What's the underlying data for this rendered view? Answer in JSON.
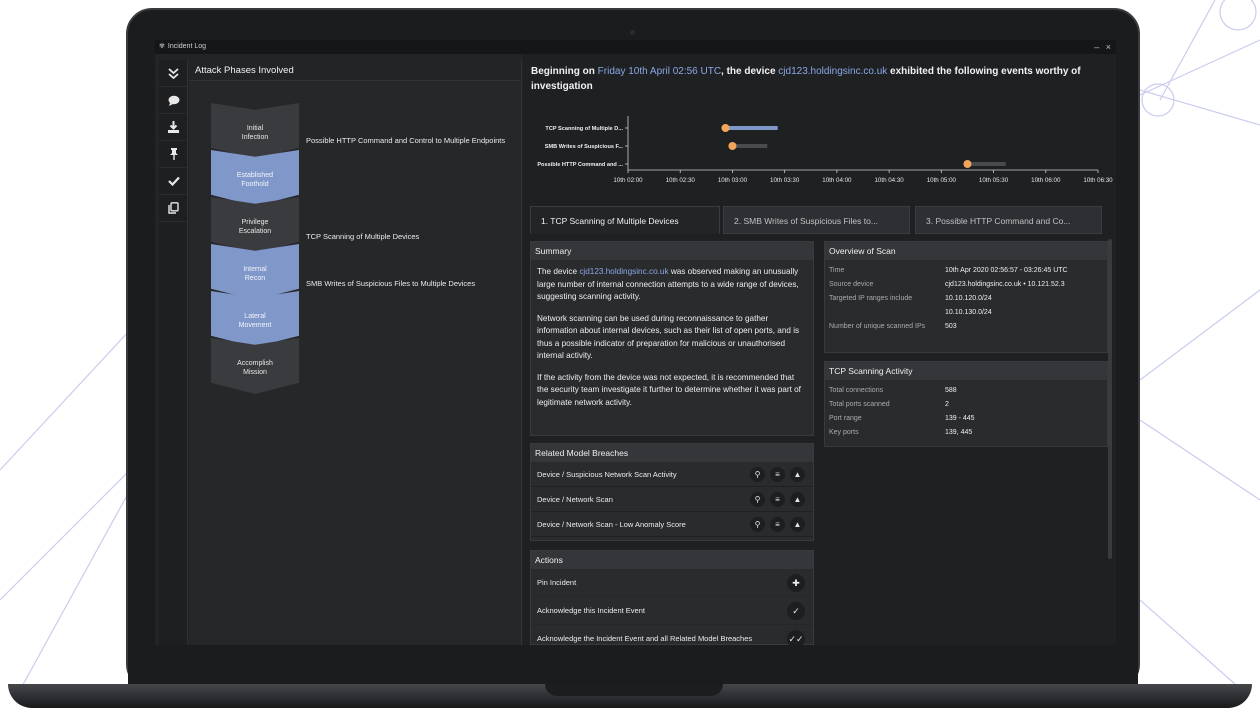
{
  "window": {
    "title": "Incident Log",
    "minimize": "–",
    "close": "×"
  },
  "toolbar": {
    "icons": [
      "double-chevron-down-icon",
      "comment-icon",
      "download-icon",
      "pin-icon",
      "check-icon",
      "copy-icon"
    ],
    "glyphs": [
      "❯❯",
      "●",
      "⤓",
      "✚",
      "✔",
      "❐"
    ]
  },
  "left": {
    "heading": "Attack Phases Involved",
    "phases": [
      {
        "label": "Initial\nInfection",
        "highlighted": false
      },
      {
        "label": "Established\nFoothold",
        "highlighted": true
      },
      {
        "label": "Privilege\nEscalation",
        "highlighted": false
      },
      {
        "label": "Internal\nRecon",
        "highlighted": true
      },
      {
        "label": "Lateral\nMovement",
        "highlighted": true
      },
      {
        "label": "Accomplish\nMission",
        "highlighted": false
      }
    ],
    "phase_events": [
      "Possible HTTP Command and Control to Multiple Endpoints",
      "TCP Scanning of Multiple Devices",
      "SMB Writes of Suspicious Files to Multiple Devices"
    ]
  },
  "header": {
    "prefix": "Beginning on ",
    "date": "Friday 10th April 02:56 UTC",
    "middle": ", the device ",
    "device": "cjd123.holdingsinc.co.uk",
    "suffix": " exhibited the following events worthy of investigation"
  },
  "chart_data": {
    "type": "timeline",
    "categories": [
      "TCP Scanning of Multiple D...",
      "SMB Writes of Suspicious F...",
      "Possible HTTP Command and ..."
    ],
    "x_ticks": [
      "10th 02:00",
      "10th 02:30",
      "10th 03:00",
      "10th 03:30",
      "10th 04:00",
      "10th 04:30",
      "10th 05:00",
      "10th 05:30",
      "10th 06:00",
      "10th 06:30"
    ],
    "events": [
      {
        "start": "10th 02:56",
        "end": "10th 03:26",
        "active": true
      },
      {
        "start": "10th 03:00",
        "end": "10th 03:20",
        "active": false
      },
      {
        "start": "10th 05:15",
        "end": "10th 05:37",
        "active": false
      }
    ],
    "colors": {
      "marker": "#f2a65a",
      "active_bar": "#7f97c9",
      "bar": "#4a4b4f"
    }
  },
  "tabs": [
    "1. TCP Scanning of Multiple Devices",
    "2. SMB Writes of Suspicious Files to...",
    "3. Possible HTTP Command and Co..."
  ],
  "summary": {
    "title": "Summary",
    "p1_prefix": "The device ",
    "p1_device": "cjd123.holdingsinc.co.uk",
    "p1_rest": " was observed making an unusually large number of internal connection attempts to a wide range of devices, suggesting scanning activity.",
    "p2": "Network scanning can be used during reconnaissance to gather information about internal devices, such as their list of open ports, and is thus a possible indicator of preparation for malicious or unauthorised internal activity.",
    "p3": "If the activity from the device was not expected, it is recommended that the security team investigate it further to determine whether it was part of legitimate network activity."
  },
  "overview": {
    "title": "Overview of Scan",
    "rows": [
      {
        "k": "Time",
        "v": "10th Apr 2020 02:56:57 - 03:26:45 UTC"
      },
      {
        "k": "Source device",
        "v": "cjd123.holdingsinc.co.uk • 10.121.52.3"
      },
      {
        "k": "Targeted IP ranges include",
        "v": "10.10.120.0/24"
      },
      {
        "k": "",
        "v": "10.10.130.0/24"
      },
      {
        "k": "Number of unique scanned IPs",
        "v": "503"
      }
    ]
  },
  "activity": {
    "title": "TCP Scanning Activity",
    "rows": [
      {
        "k": "Total connections",
        "v": "588"
      },
      {
        "k": "Total ports scanned",
        "v": "2"
      },
      {
        "k": "Port range",
        "v": "139 - 445"
      },
      {
        "k": "Key ports",
        "v": "139, 445"
      }
    ]
  },
  "breaches": {
    "title": "Related Model Breaches",
    "items": [
      "Device / Suspicious Network Scan Activity",
      "Device / Network Scan",
      "Device / Network Scan - Low Anomaly Score"
    ]
  },
  "actions": {
    "title": "Actions",
    "items": [
      {
        "label": "Pin Incident",
        "icon": "pin-icon",
        "glyph": "✚"
      },
      {
        "label": "Acknowledge this Incident Event",
        "icon": "check-icon",
        "glyph": "✓"
      },
      {
        "label": "Acknowledge the Incident Event and all Related Model Breaches",
        "icon": "double-check-icon",
        "glyph": "✓✓"
      }
    ]
  }
}
